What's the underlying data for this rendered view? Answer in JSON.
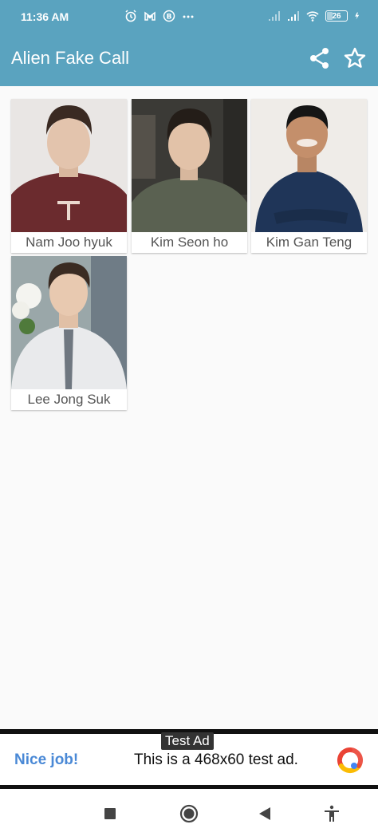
{
  "status_bar": {
    "time": "11:36 AM",
    "battery": "26",
    "icons_left": [
      "alarm-icon",
      "gmail-icon",
      "b-badge-icon",
      "more-dots-icon"
    ],
    "icons_right": [
      "signal-icon",
      "signal-icon",
      "wifi-icon",
      "battery-icon",
      "charging-icon"
    ]
  },
  "app_bar": {
    "title": "Alien Fake Call",
    "color": "#5aa3bf",
    "actions": [
      "share-icon",
      "star-icon"
    ]
  },
  "contacts": [
    {
      "name": "Nam Joo hyuk"
    },
    {
      "name": "Kim Seon ho"
    },
    {
      "name": "Kim Gan Teng"
    },
    {
      "name": "Lee Jong Suk"
    }
  ],
  "ad": {
    "badge": "Test Ad",
    "headline": "Nice job!",
    "text": "This is a 468x60 test ad."
  },
  "nav_bar": {
    "buttons": [
      "recents-icon",
      "home-icon",
      "back-icon",
      "accessibility-icon"
    ]
  }
}
